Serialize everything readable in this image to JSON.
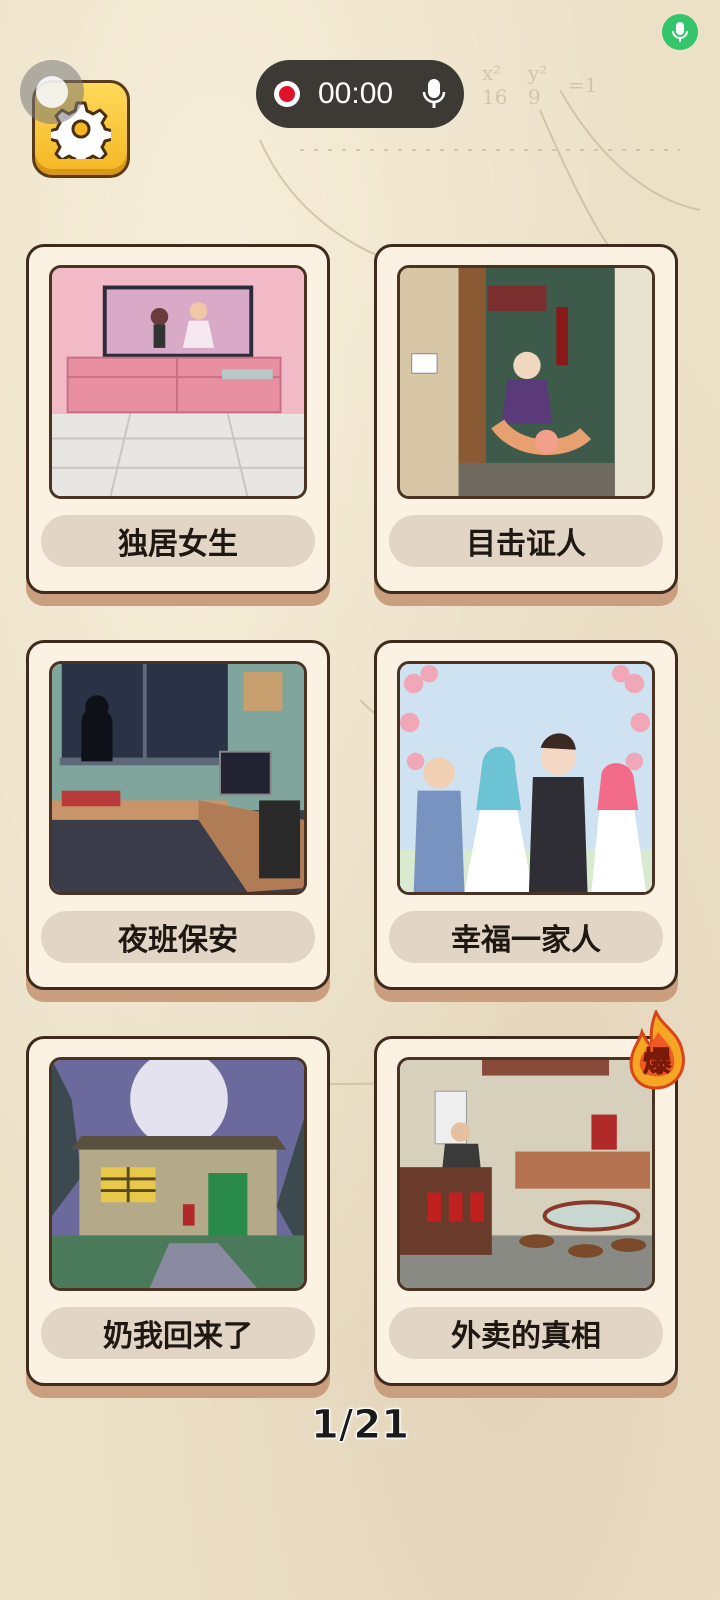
{
  "recording": {
    "time": "00:00"
  },
  "levels": [
    {
      "title": "独居女生"
    },
    {
      "title": "目击证人"
    },
    {
      "title": "夜班保安"
    },
    {
      "title": "幸福一家人"
    },
    {
      "title": "奶我回来了"
    },
    {
      "title": "外卖的真相",
      "badge": "爆"
    }
  ],
  "pagination": {
    "text": "1/21"
  },
  "colors": {
    "background": "#ece0c7",
    "card": "#fbf2e3",
    "label_pill": "#e2d5c6",
    "settings_button": "#f4b623",
    "mic_indicator": "#34c46a",
    "record_dot": "#e0132a"
  }
}
